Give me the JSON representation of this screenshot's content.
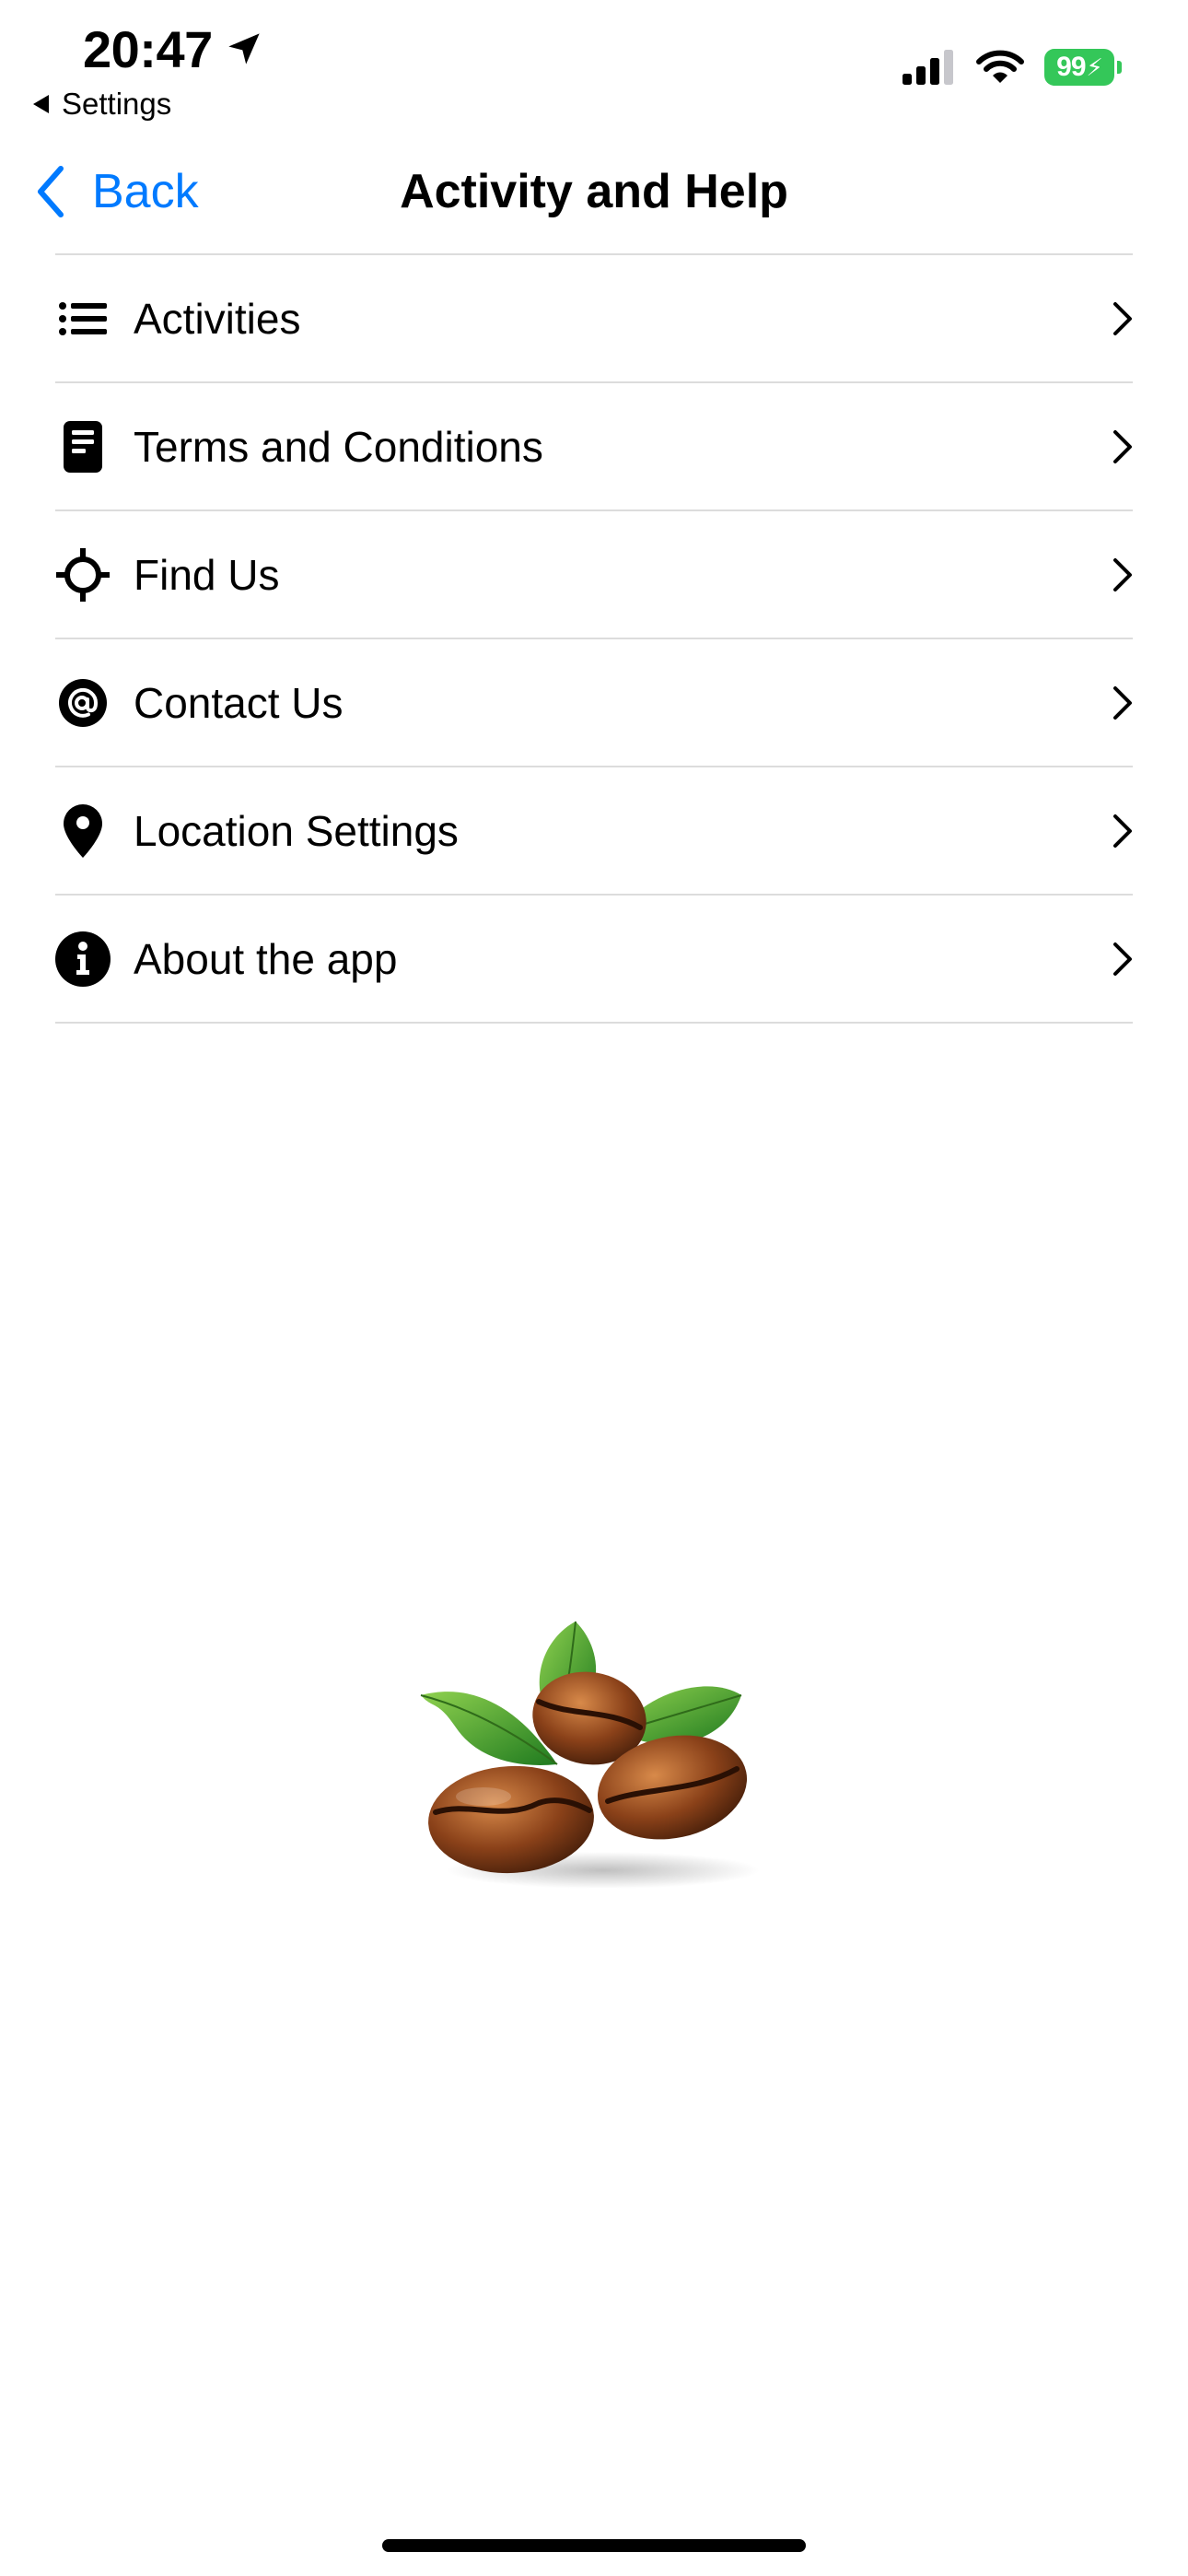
{
  "status_bar": {
    "time": "20:47",
    "back_app_label": "Settings",
    "battery": "99",
    "icons": [
      "location-arrow-icon",
      "cellular-signal-icon",
      "wifi-icon",
      "battery-icon"
    ]
  },
  "nav": {
    "back_label": "Back",
    "title": "Activity and Help",
    "accent_color": "#007aff"
  },
  "menu": {
    "items": [
      {
        "label": "Activities",
        "icon": "list-icon"
      },
      {
        "label": "Terms and Conditions",
        "icon": "document-icon"
      },
      {
        "label": "Find Us",
        "icon": "crosshair-icon"
      },
      {
        "label": "Contact Us",
        "icon": "at-sign-icon"
      },
      {
        "label": "Location Settings",
        "icon": "map-pin-icon"
      },
      {
        "label": "About the app",
        "icon": "info-icon"
      }
    ]
  },
  "illustration": {
    "icon": "coffee-beans-illustration"
  }
}
